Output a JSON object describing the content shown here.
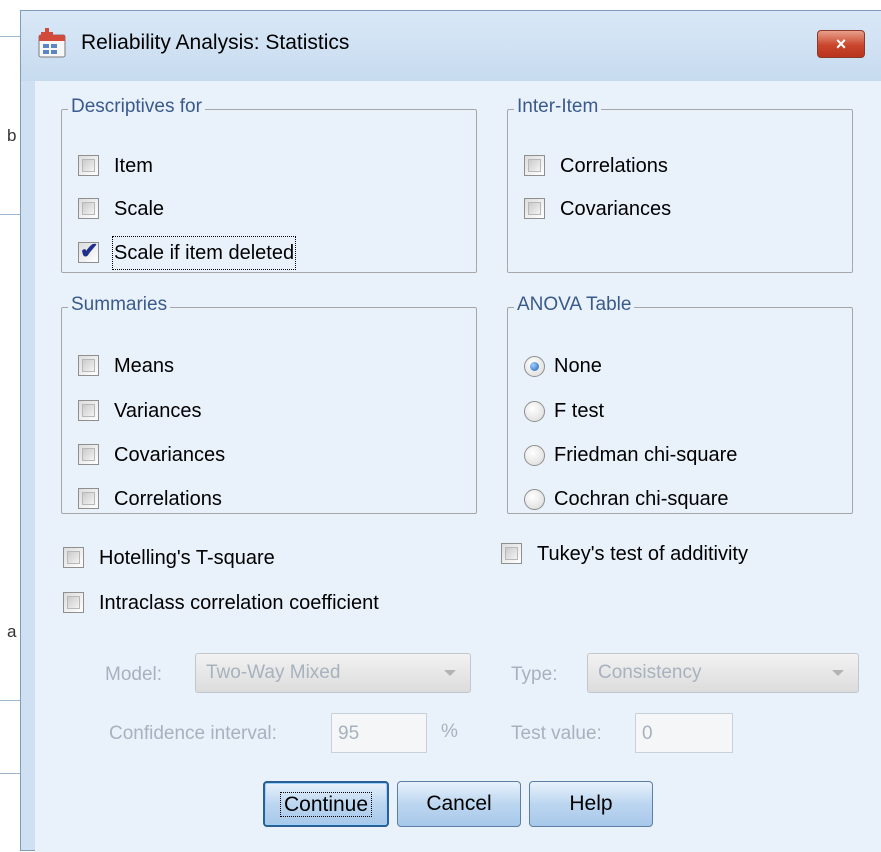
{
  "background_app": {
    "visible_chars": [
      "b",
      "a"
    ]
  },
  "window": {
    "title": "Reliability Analysis: Statistics",
    "icon": "spss-dialog-icon",
    "close_label": "×"
  },
  "descriptives": {
    "title": "Descriptives for",
    "items": [
      {
        "label": "Item",
        "checked": false
      },
      {
        "label": "Scale",
        "checked": false
      },
      {
        "label": "Scale if item deleted",
        "checked": true
      }
    ]
  },
  "inter_item": {
    "title": "Inter-Item",
    "items": [
      {
        "label": "Correlations",
        "checked": false
      },
      {
        "label": "Covariances",
        "checked": false
      }
    ]
  },
  "summaries": {
    "title": "Summaries",
    "items": [
      {
        "label": "Means",
        "checked": false
      },
      {
        "label": "Variances",
        "checked": false
      },
      {
        "label": "Covariances",
        "checked": false
      },
      {
        "label": "Correlations",
        "checked": false
      }
    ]
  },
  "anova": {
    "title": "ANOVA Table",
    "options": [
      {
        "label": "None",
        "selected": true
      },
      {
        "label": "F test",
        "selected": false
      },
      {
        "label": "Friedman chi-square",
        "selected": false
      },
      {
        "label": "Cochran chi-square",
        "selected": false
      }
    ]
  },
  "options": {
    "hotelling": {
      "label": "Hotelling's T-square",
      "checked": false
    },
    "tukey": {
      "label": "Tukey's test of additivity",
      "checked": false
    },
    "icc": {
      "label": "Intraclass correlation coefficient",
      "checked": false
    }
  },
  "icc_settings": {
    "model_label": "Model:",
    "model_value": "Two-Way Mixed",
    "type_label": "Type:",
    "type_value": "Consistency",
    "ci_label": "Confidence interval:",
    "ci_value": "95",
    "ci_unit": "%",
    "test_value_label": "Test value:",
    "test_value": "0"
  },
  "buttons": {
    "continue": "Continue",
    "cancel": "Cancel",
    "help": "Help"
  },
  "colors": {
    "group_title": "#3a5a8c",
    "dialog_bg": "#e9f1fb",
    "close_button": "#c9452c",
    "disabled_text": "#a7b2be"
  }
}
